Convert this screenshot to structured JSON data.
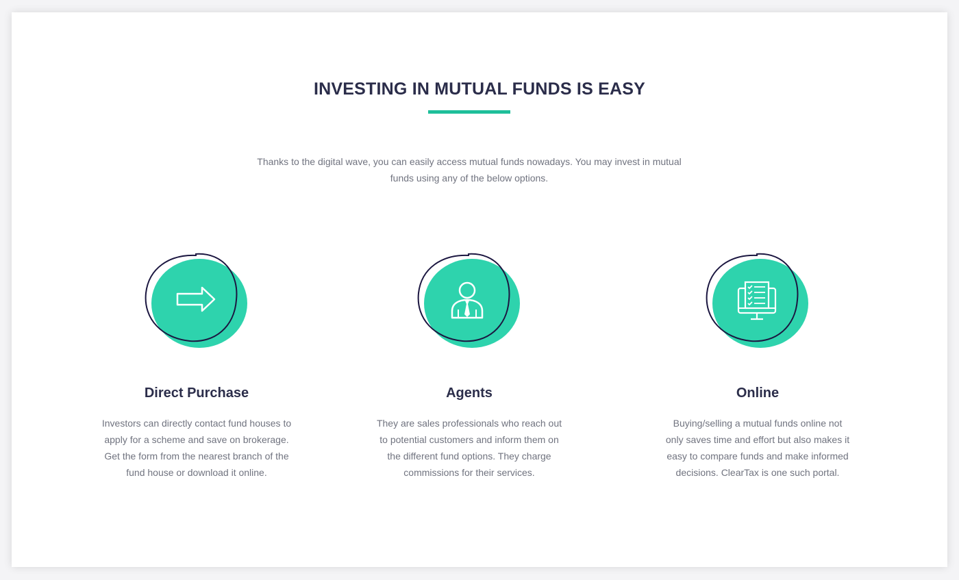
{
  "section": {
    "title": "INVESTING IN MUTUAL FUNDS IS EASY",
    "intro_line1": "Thanks to the digital wave, you can easily access mutual funds nowadays. You may invest in mutual",
    "intro_line2": "funds using any of the below options."
  },
  "colors": {
    "accent": "#2ed3ad",
    "underline": "#1fbf9a",
    "heading": "#2b2d4a",
    "body_text": "#70737f",
    "outline": "#1b1640"
  },
  "options": [
    {
      "icon": "arrow-right-icon",
      "title": "Direct Purchase",
      "lines": [
        "Investors can directly contact fund houses to",
        "apply for a scheme and save on brokerage.",
        "Get the form from the nearest branch of the",
        "fund house or download it online."
      ]
    },
    {
      "icon": "agent-person-icon",
      "title": "Agents",
      "lines": [
        "They are sales professionals who reach out",
        "to potential customers and inform them on",
        "the different fund options.  They charge",
        "commissions for their services."
      ]
    },
    {
      "icon": "online-monitor-checklist-icon",
      "title": "Online",
      "lines": [
        "Buying/selling a mutual funds online not",
        "only saves time and effort but also makes it",
        "easy to compare funds and make informed",
        "decisions.  ClearTax is one such portal."
      ]
    }
  ]
}
